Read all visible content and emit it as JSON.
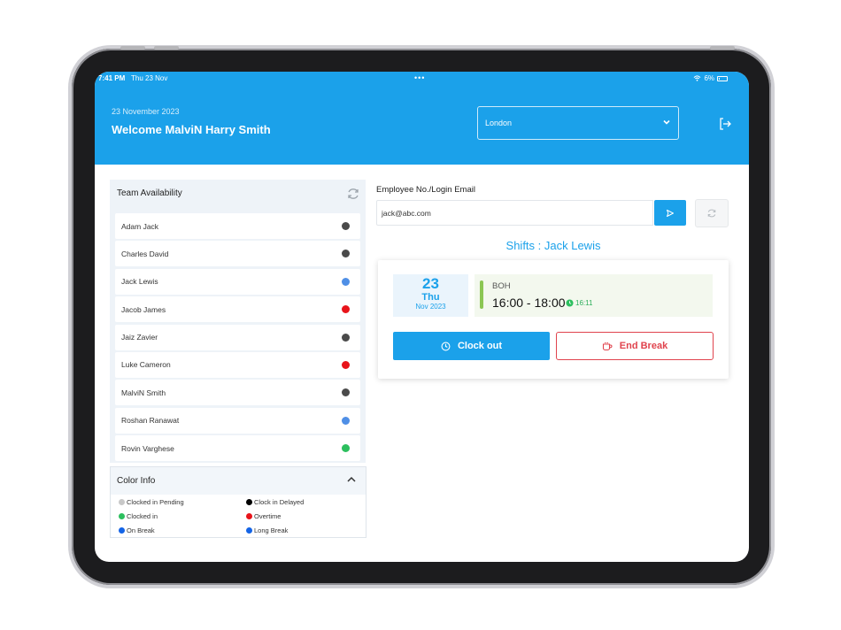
{
  "status_bar": {
    "time": "7:41 PM",
    "date": "Thu 23 Nov",
    "dots": "•••",
    "battery": "6%"
  },
  "header": {
    "date": "23 November 2023",
    "welcome": "Welcome MalviN Harry Smith",
    "location": "London"
  },
  "team": {
    "title": "Team Availability",
    "members": [
      {
        "name": "Adam Jack",
        "color": "#4a4a4a"
      },
      {
        "name": "Charles David",
        "color": "#4a4a4a"
      },
      {
        "name": "Jack Lewis",
        "color": "#4f8fe6"
      },
      {
        "name": "Jacob James",
        "color": "#e8141a"
      },
      {
        "name": "Jaiz Zavier",
        "color": "#4a4a4a"
      },
      {
        "name": "Luke Cameron",
        "color": "#e8141a"
      },
      {
        "name": "MalviN Smith",
        "color": "#4a4a4a"
      },
      {
        "name": "Roshan Ranawat",
        "color": "#4f8fe6"
      },
      {
        "name": "Rovin Varghese",
        "color": "#2cbf5e"
      }
    ]
  },
  "color_info": {
    "title": "Color Info",
    "items": [
      {
        "label": "Clocked in Pending",
        "color": "#c8c8c8"
      },
      {
        "label": "Clock in Delayed",
        "color": "#000000"
      },
      {
        "label": "Clocked in",
        "color": "#2cbf5e"
      },
      {
        "label": "Overtime",
        "color": "#e8141a"
      },
      {
        "label": "On Break",
        "color": "#1464e6"
      },
      {
        "label": "Long Break",
        "color": "#1464e6"
      }
    ]
  },
  "employee": {
    "label": "Employee No./Login Email",
    "value": "jack@abc.com"
  },
  "shift": {
    "title": "Shifts : Jack Lewis",
    "day": "23",
    "weekday": "Thu",
    "month_year": "Nov 2023",
    "role": "BOH",
    "time_range": "16:00 - 18:00",
    "clock_time": "16:11",
    "clock_out_label": "Clock out",
    "end_break_label": "End Break"
  },
  "colors": {
    "primary": "#1ba1ea",
    "danger": "#e0434d",
    "success": "#2cbf5e"
  }
}
